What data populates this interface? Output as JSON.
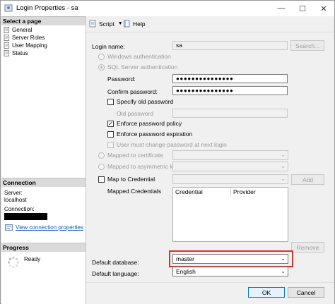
{
  "window": {
    "title": "Login Properties - sa",
    "minimize_glyph": "—",
    "maximize_glyph": "☐",
    "close_glyph": "✕"
  },
  "left_pane": {
    "select_page_header": "Select a page",
    "pages": [
      {
        "label": "General",
        "icon": "page-icon"
      },
      {
        "label": "Server Roles",
        "icon": "page-icon"
      },
      {
        "label": "User Mapping",
        "icon": "page-icon"
      },
      {
        "label": "Status",
        "icon": "page-icon"
      }
    ],
    "connection_header": "Connection",
    "server_label": "Server:",
    "server_value": "localhost",
    "connection_label": "Connection:",
    "view_connection_link": "View connection properties",
    "progress_header": "Progress",
    "progress_status": "Ready"
  },
  "toolbar": {
    "script_label": "Script",
    "help_label": "Help"
  },
  "form": {
    "login_name_label": "Login name:",
    "login_name_value": "sa",
    "search_button": "Search...",
    "windows_auth_label": "Windows authentication",
    "sql_auth_label": "SQL Server authentication",
    "password_label": "Password:",
    "password_value": "●●●●●●●●●●●●●●●",
    "confirm_password_label": "Confirm password:",
    "confirm_password_value": "●●●●●●●●●●●●●●●",
    "specify_old_password_label": "Specify old password",
    "old_password_label": "Old password",
    "enforce_policy_label": "Enforce password policy",
    "enforce_policy_checked": true,
    "enforce_expiration_label": "Enforce password expiration",
    "must_change_label": "User must change password at next login",
    "mapped_certificate_label": "Mapped to certificate",
    "mapped_asym_key_label": "Mapped to asymmetric key",
    "map_credential_label": "Map to Credential",
    "add_button": "Add",
    "mapped_credentials_label": "Mapped Credentials",
    "credentials_columns": [
      "Credential",
      "Provider"
    ],
    "remove_button": "Remove",
    "default_database_label": "Default database:",
    "default_database_value": "master",
    "default_language_label": "Default language:",
    "default_language_value": "English"
  },
  "footer": {
    "ok_button": "OK",
    "cancel_button": "Cancel"
  },
  "colors": {
    "highlight_border": "#d9342b",
    "link": "#0b5cad",
    "section_header_bg": "#dadada"
  }
}
